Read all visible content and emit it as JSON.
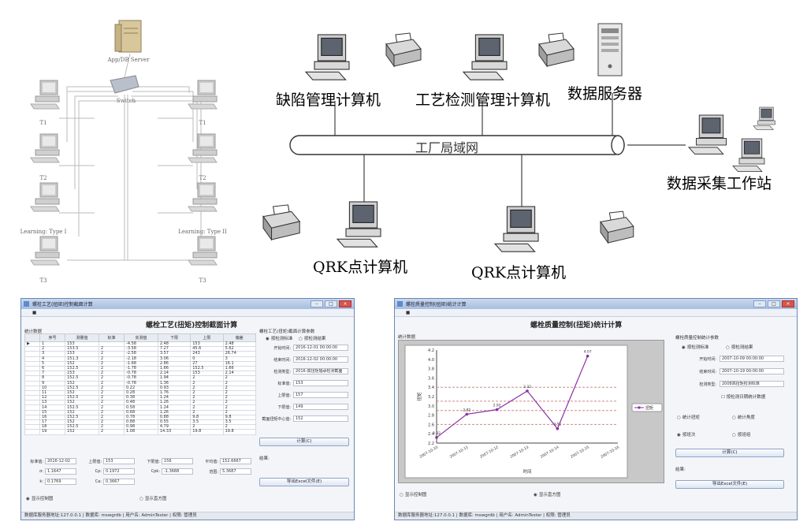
{
  "left_diagram": {
    "server_label": "App/DB Server",
    "switch_label": "Switch",
    "left_terminals": [
      "T1",
      "T2",
      "Learning: Type I",
      "T3"
    ],
    "right_terminals": [
      "T1",
      "T2",
      "Learning: Type II",
      "T3"
    ]
  },
  "right_diagram": {
    "defect_pc": "缺陷管理计算机",
    "process_pc": "工艺检测管理计算机",
    "data_server": "数据服务器",
    "lan": "工厂局域网",
    "acquisition": "数据采集工作站",
    "qrk_pc_1": "QRK点计算机",
    "qrk_pc_2": "QRK点计算机"
  },
  "window_left": {
    "title": "螺栓工艺(扭矩)控制截面计算",
    "grid_group": "统计数据",
    "columns": [
      "序号",
      "测量值",
      "标准",
      "实测值",
      "下限",
      "上限",
      "偏差"
    ],
    "rows": [
      [
        "1",
        "153",
        "",
        "-4.58",
        "2.48",
        "153",
        "2.48"
      ],
      [
        "2",
        "153.5",
        "2",
        "-3.58",
        "7.27",
        "45.6",
        "5.62"
      ],
      [
        "3",
        "153",
        "2",
        "-2.58",
        "3.57",
        "243",
        "26.74"
      ],
      [
        "4",
        "151.3",
        "2",
        "-2.18",
        "3.06",
        "0",
        "3"
      ],
      [
        "5",
        "152",
        "2",
        "-1.68",
        "2.86",
        "27",
        "16.1"
      ],
      [
        "6",
        "152.5",
        "2",
        "-1.78",
        "1.66",
        "152.5",
        "1.66"
      ],
      [
        "7",
        "153",
        "2",
        "-0.78",
        "2.14",
        "153",
        "2.14"
      ],
      [
        "8",
        "152.5",
        "2",
        "-0.78",
        "1.94",
        "2",
        "2"
      ],
      [
        "9",
        "152",
        "2",
        "-0.78",
        "1.36",
        "2",
        "2"
      ],
      [
        "10",
        "152.5",
        "2",
        "0.22",
        "0.93",
        "2",
        "2"
      ],
      [
        "11",
        "152",
        "2",
        "0.28",
        "1.76",
        "2",
        "2"
      ],
      [
        "12",
        "152.5",
        "2",
        "0.38",
        "1.24",
        "2",
        "2"
      ],
      [
        "13",
        "152",
        "2",
        "0.48",
        "1.26",
        "2",
        "2"
      ],
      [
        "14",
        "152.5",
        "2",
        "0.58",
        "1.24",
        "2",
        "2"
      ],
      [
        "15",
        "152",
        "2",
        "0.68",
        "1.26",
        "2",
        "2"
      ],
      [
        "16",
        "152.5",
        "2",
        "0.78",
        "0.88",
        "9.8",
        "9.8"
      ],
      [
        "17",
        "152",
        "2",
        "0.88",
        "0.55",
        "3.5",
        "3.5"
      ],
      [
        "18",
        "152.5",
        "2",
        "0.98",
        "4.79",
        "2",
        "2"
      ],
      [
        "19",
        "152",
        "2",
        "1.08",
        "14.33",
        "19.8",
        "19.8"
      ]
    ],
    "side": {
      "group": "螺栓工艺(扭矩)截面计算参数",
      "radio_a": "按检测标准",
      "radio_b": "按检测结果",
      "fields": [
        {
          "label": "开始时间:",
          "value": "2016-12-01 00:00:00"
        },
        {
          "label": "结束时间:",
          "value": "2016-12-02 00:00:00"
        },
        {
          "label": "检测类型:",
          "value": "2016-高扭矩轴承检测截面"
        },
        {
          "label": "标准值:",
          "value": "153"
        },
        {
          "label": "上限值:",
          "value": "157"
        },
        {
          "label": "下限值:",
          "value": "149"
        },
        {
          "label": "截面扭矩中心值:",
          "value": "152"
        }
      ],
      "calc_button": "计算(C)",
      "result_label": "结果:",
      "export_button": "导出Excel文件(E)"
    },
    "bottom_fields": [
      {
        "label": "标准值:",
        "value": "2016-12-02"
      },
      {
        "label": "上限值:",
        "value": "153"
      },
      {
        "label": "下限值:",
        "value": "156"
      },
      {
        "label": "平均值:",
        "value": "152.6667"
      },
      {
        "label": "σ:",
        "value": "1.1647"
      },
      {
        "label": "Cp:",
        "value": "0.1972"
      },
      {
        "label": "Cpk:",
        "value": "-1.3688"
      },
      {
        "label": "范围:",
        "value": "5.3687"
      },
      {
        "label": "k:",
        "value": "0.1769"
      },
      {
        "label": "Ca:",
        "value": "0.3667"
      }
    ],
    "radio_plot": "显示控制图",
    "radio_hist": "显示直方图",
    "status": "数据库服务器地址:127.0.0.1 | 数据库: mswgrdb | 用户名: AdminTester | 权限: 管理员"
  },
  "window_right": {
    "title": "螺栓质量控制(扭矩)统计计算",
    "chart_group": "统计数据",
    "side": {
      "group": "螺栓质量控制统计参数",
      "radio_a": "按检测标准",
      "radio_b": "按检测结果",
      "fields": [
        {
          "label": "开始时间:",
          "value": "2007-10-09 00:00:00"
        },
        {
          "label": "结束时间:",
          "value": "2007-10-19 00:00:00"
        },
        {
          "label": "检测类型:",
          "value": "2008高扭矩检测标准"
        }
      ],
      "checkbox": "按检测日期统计数据",
      "radio_c": "统计扭矩",
      "radio_d": "统计角度",
      "radio_e": "按班次",
      "radio_f": "按班组",
      "calc_button": "计算(C)",
      "result_label": "结果:",
      "export_button": "导出Excel文件(E)"
    },
    "radio_plot": "显示控制图",
    "radio_hist": "显示直方图",
    "status": "数据库服务器地址:127.0.0.1 | 数据库: mswgrdb | 用户名: AdminTester | 权限: 管理员"
  },
  "chart_data": {
    "type": "line",
    "categories": [
      "2007-10-10",
      "2007-10-11",
      "2007-10-12",
      "2007-10-13",
      "2007-10-14",
      "2007-10-15",
      "2007-10-16"
    ],
    "series": [
      {
        "name": "扭矩",
        "values": [
          2.32,
          2.82,
          2.92,
          3.32,
          2.51,
          4.07
        ]
      }
    ],
    "data_labels": [
      "2.32",
      "2.82",
      "2.92",
      "3.32",
      "2.51",
      "4.07"
    ],
    "ylim": [
      2.2,
      4.2
    ],
    "xlabel": "时间",
    "ylabel": "扭矩",
    "reference_lines": [
      2.6,
      2.9,
      3.1,
      3.4
    ],
    "colors": {
      "series": "#8b2fa0",
      "reference": "#d08a8a"
    },
    "legend": "right"
  }
}
